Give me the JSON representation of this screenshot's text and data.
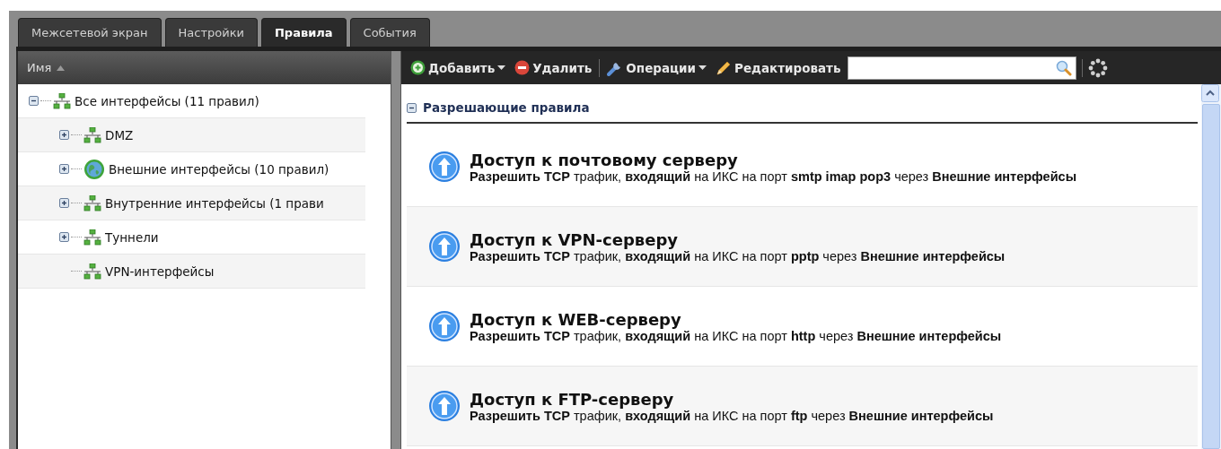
{
  "tabs": [
    {
      "label": "Межсетевой экран",
      "selected": false
    },
    {
      "label": "Настройки",
      "selected": false
    },
    {
      "label": "Правила",
      "selected": true
    },
    {
      "label": "События",
      "selected": false
    }
  ],
  "tree": {
    "column": "Имя",
    "sort_ascending": true,
    "items": [
      {
        "label": "Все интерфейсы (11 правил)",
        "kind": "network",
        "expandable": true,
        "expanded": true,
        "children": [
          {
            "label": "DMZ",
            "kind": "network",
            "expandable": true,
            "expanded": false
          },
          {
            "label": "Внешние интерфейсы (10 правил)",
            "kind": "globe",
            "expandable": true,
            "expanded": false
          },
          {
            "label": "Внутренние интерфейсы (1 прави",
            "kind": "network",
            "expandable": true,
            "expanded": false
          },
          {
            "label": "Туннели",
            "kind": "network",
            "expandable": true,
            "expanded": false
          },
          {
            "label": "VPN-интерфейсы",
            "kind": "network",
            "expandable": false
          }
        ]
      }
    ]
  },
  "toolbar": {
    "buttons": [
      {
        "label": "Добавить",
        "kind": "add",
        "dropdown": true
      },
      {
        "label": "Удалить",
        "kind": "delete",
        "dropdown": false
      },
      {
        "label": "Операции",
        "kind": "operations",
        "dropdown": true
      },
      {
        "label": "Редактировать",
        "kind": "edit",
        "dropdown": false
      }
    ]
  },
  "section": {
    "title": "Разрешающие правила",
    "expanded": true
  },
  "rules": [
    {
      "title": "Доступ к почтовому серверу",
      "description": "**Разрешить TCP** трафик, **входящий** на ИКС на порт **smtp imap pop3** через **Внешние интерфейсы**"
    },
    {
      "title": "Доступ к VPN-серверу",
      "description": "**Разрешить TCP** трафик, **входящий** на ИКС на порт **pptp** через **Внешние интерфейсы**"
    },
    {
      "title": "Доступ к WEB-серверу",
      "description": "**Разрешить TCP** трафик, **входящий** на ИКС на порт **http** через **Внешние интерфейсы**"
    },
    {
      "title": "Доступ к FTP-серверу",
      "description": "**Разрешить TCP** трафик, **входящий** на ИКС на порт **ftp** через **Внешние интерфейсы**"
    }
  ]
}
